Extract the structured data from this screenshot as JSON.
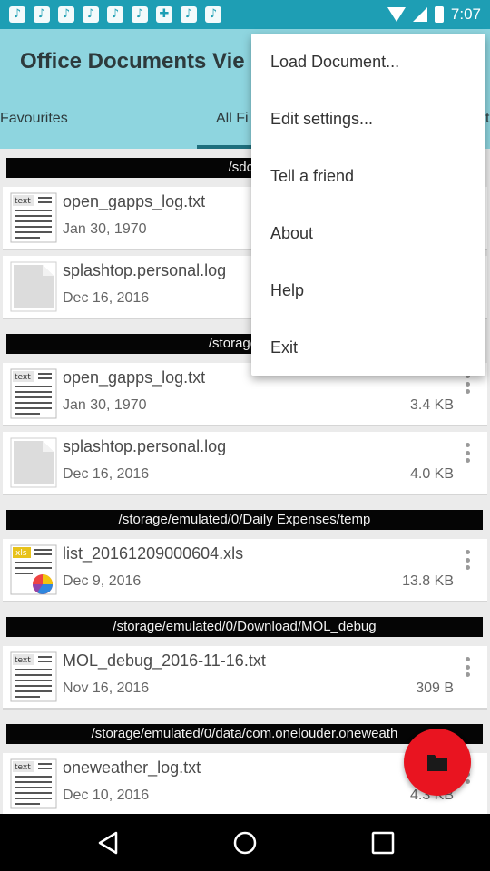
{
  "status_bar": {
    "time": "7:07",
    "notification_icons": [
      "music-note-icon",
      "music-note-icon",
      "music-note-icon",
      "music-note-icon",
      "music-note-icon",
      "music-note-icon",
      "puzzle-icon",
      "music-note-icon",
      "music-note-icon"
    ]
  },
  "app_bar": {
    "title": "Office Documents Vie"
  },
  "tabs": [
    {
      "label": "Favourites"
    },
    {
      "label": "All Fi"
    },
    {
      "label": "t"
    }
  ],
  "list": {
    "paths": [
      "/sdca",
      "/storage/em",
      "/storage/emulated/0/Daily Expenses/temp",
      "/storage/emulated/0/Download/MOL_debug",
      "/storage/emulated/0/data/com.onelouder.oneweath"
    ],
    "files": [
      {
        "name": "open_gapps_log.txt",
        "date": "Jan 30, 1970",
        "size": "",
        "icon": "text-file-icon"
      },
      {
        "name": "splashtop.personal.log",
        "date": "Dec 16, 2016",
        "size": "",
        "icon": "generic-file-icon"
      },
      {
        "name": "open_gapps_log.txt",
        "date": "Jan 30, 1970",
        "size": "3.4 KB",
        "icon": "text-file-icon"
      },
      {
        "name": "splashtop.personal.log",
        "date": "Dec 16, 2016",
        "size": "4.0 KB",
        "icon": "generic-file-icon"
      },
      {
        "name": "list_20161209000604.xls",
        "date": "Dec 9, 2016",
        "size": "13.8 KB",
        "icon": "spreadsheet-file-icon"
      },
      {
        "name": "MOL_debug_2016-11-16.txt",
        "date": "Nov 16, 2016",
        "size": "309 B",
        "icon": "text-file-icon"
      },
      {
        "name": "oneweather_log.txt",
        "date": "Dec 10, 2016",
        "size": "4.3 KB",
        "icon": "text-file-icon"
      }
    ]
  },
  "thumb_labels": {
    "text": "text",
    "xls": "xls"
  },
  "menu": {
    "items": [
      {
        "label": "Load Document..."
      },
      {
        "label": "Edit settings..."
      },
      {
        "label": "Tell a friend"
      },
      {
        "label": "About"
      },
      {
        "label": "Help"
      },
      {
        "label": "Exit"
      }
    ]
  },
  "colors": {
    "status_bar": "#1e9eb4",
    "app_bar": "#8ed5df",
    "fab": "#e91420",
    "path_bar": "#050505"
  }
}
